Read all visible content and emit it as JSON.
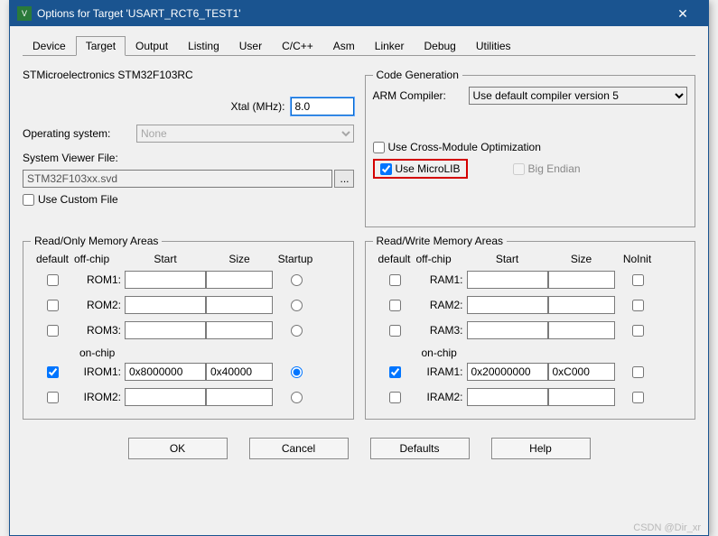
{
  "title": "Options for Target 'USART_RCT6_TEST1'",
  "tabs": [
    "Device",
    "Target",
    "Output",
    "Listing",
    "User",
    "C/C++",
    "Asm",
    "Linker",
    "Debug",
    "Utilities"
  ],
  "activeTab": "Target",
  "device": "STMicroelectronics STM32F103RC",
  "xtal_label": "Xtal (MHz):",
  "xtal_value": "8.0",
  "os_label": "Operating system:",
  "os_value": "None",
  "svf_label": "System Viewer File:",
  "svf_value": "STM32F103xx.svd",
  "use_custom_file": "Use Custom File",
  "codegen": {
    "legend": "Code Generation",
    "compiler_label": "ARM Compiler:",
    "compiler_value": "Use default compiler version 5",
    "cross_module": "Use Cross-Module Optimization",
    "microlib": "Use MicroLIB",
    "big_endian": "Big Endian"
  },
  "readonly": {
    "legend": "Read/Only Memory Areas",
    "h_default": "default",
    "h_offchip": "off-chip",
    "h_start": "Start",
    "h_size": "Size",
    "h_startup": "Startup",
    "onchip": "on-chip",
    "rows": [
      {
        "name": "ROM1:",
        "def": false,
        "start": "",
        "size": "",
        "startup": false
      },
      {
        "name": "ROM2:",
        "def": false,
        "start": "",
        "size": "",
        "startup": false
      },
      {
        "name": "ROM3:",
        "def": false,
        "start": "",
        "size": "",
        "startup": false
      }
    ],
    "onrows": [
      {
        "name": "IROM1:",
        "def": true,
        "start": "0x8000000",
        "size": "0x40000",
        "startup": true
      },
      {
        "name": "IROM2:",
        "def": false,
        "start": "",
        "size": "",
        "startup": false
      }
    ]
  },
  "readwrite": {
    "legend": "Read/Write Memory Areas",
    "h_default": "default",
    "h_offchip": "off-chip",
    "h_start": "Start",
    "h_size": "Size",
    "h_noinit": "NoInit",
    "onchip": "on-chip",
    "rows": [
      {
        "name": "RAM1:",
        "def": false,
        "start": "",
        "size": "",
        "noinit": false
      },
      {
        "name": "RAM2:",
        "def": false,
        "start": "",
        "size": "",
        "noinit": false
      },
      {
        "name": "RAM3:",
        "def": false,
        "start": "",
        "size": "",
        "noinit": false
      }
    ],
    "onrows": [
      {
        "name": "IRAM1:",
        "def": true,
        "start": "0x20000000",
        "size": "0xC000",
        "noinit": false
      },
      {
        "name": "IRAM2:",
        "def": false,
        "start": "",
        "size": "",
        "noinit": false
      }
    ]
  },
  "buttons": {
    "ok": "OK",
    "cancel": "Cancel",
    "defaults": "Defaults",
    "help": "Help"
  },
  "watermark": "CSDN @Dir_xr"
}
